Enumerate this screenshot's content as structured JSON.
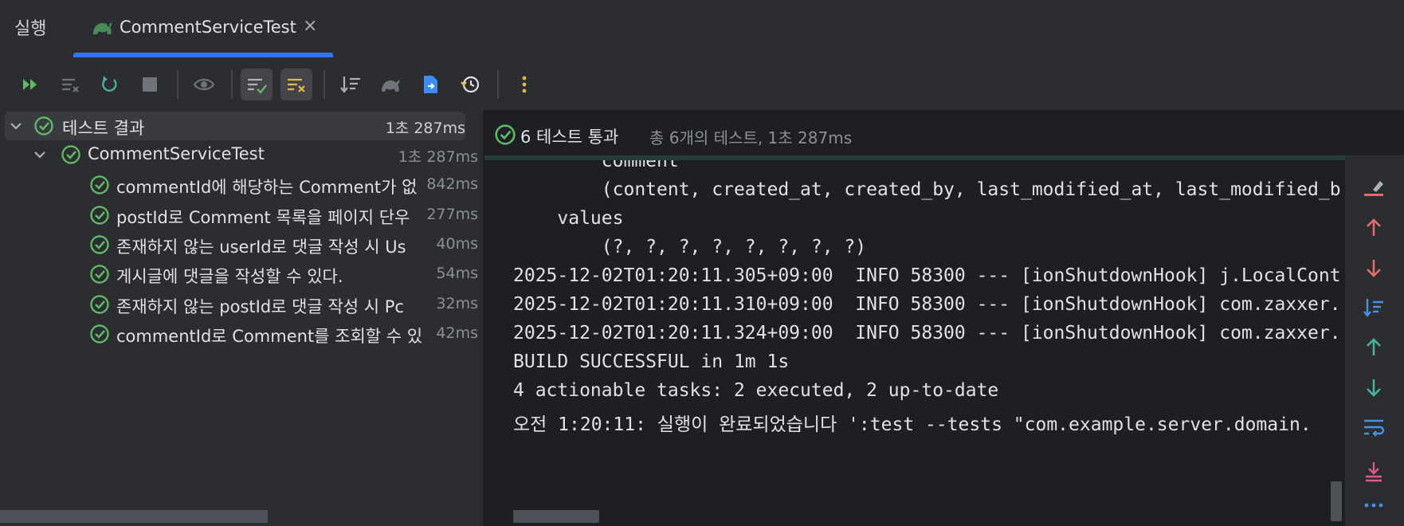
{
  "window": {
    "run_label": "실행",
    "tab_title": "CommentServiceTest",
    "tab_close": "×"
  },
  "toolbar": {
    "buttons": [
      {
        "icon": "rerun-failed-icon"
      },
      {
        "icon": "clear-icon"
      },
      {
        "icon": "rerun-icon"
      },
      {
        "icon": "stop-icon"
      },
      {
        "icon": "eye-icon"
      },
      {
        "icon": "show-passed-icon",
        "active": true
      },
      {
        "icon": "show-ignored-icon",
        "active": true
      },
      {
        "icon": "sort-icon"
      },
      {
        "icon": "gradle-icon"
      },
      {
        "icon": "export-icon"
      },
      {
        "icon": "history-icon"
      },
      {
        "icon": "more-icon"
      }
    ]
  },
  "tree": {
    "root": {
      "label": "테스트 결과",
      "time": "1초 287ms"
    },
    "suite": {
      "label": "CommentServiceTest",
      "time": "1초 287ms"
    },
    "tests": [
      {
        "label": "commentId에 해당하는 Comment가 없",
        "time": "842ms"
      },
      {
        "label": "postId로 Comment 목록을 페이지 단우",
        "time": "277ms"
      },
      {
        "label": "존재하지 않는 userId로 댓글 작성 시 Us",
        "time": "40ms"
      },
      {
        "label": "게시글에 댓글을 작성할 수 있다.",
        "time": "54ms"
      },
      {
        "label": "존재하지 않는 postId로 댓글 작성 시 Pc",
        "time": "32ms"
      },
      {
        "label": "commentId로 Comment를 조회할 수 있",
        "time": "42ms"
      }
    ]
  },
  "status": {
    "passed": "6 테스트 통과",
    "total": "총 6개의 테스트, 1초 287ms"
  },
  "console": {
    "lines": [
      "        comment",
      "        (content, created_at, created_by, last_modified_at, last_modified_b",
      "    values",
      "        (?, ?, ?, ?, ?, ?, ?, ?)",
      "2025-12-02T01:20:11.305+09:00  INFO 58300 --- [ionShutdownHook] j.LocalCont",
      "2025-12-02T01:20:11.310+09:00  INFO 58300 --- [ionShutdownHook] com.zaxxer.",
      "2025-12-02T01:20:11.324+09:00  INFO 58300 --- [ionShutdownHook] com.zaxxer.",
      "BUILD SUCCESSFUL in 1m 1s",
      "4 actionable tasks: 2 executed, 2 up-to-date",
      "오전 1:20:11: 실행이 완료되었습니다 ':test --tests \"com.example.server.domain."
    ]
  },
  "right_toolbar": [
    {
      "icon": "clear-console-icon"
    },
    {
      "icon": "arrow-up-red-icon"
    },
    {
      "icon": "arrow-down-red-icon"
    },
    {
      "icon": "sort-blue-icon"
    },
    {
      "icon": "arrow-up-icon"
    },
    {
      "icon": "arrow-down-icon"
    },
    {
      "icon": "soft-wrap-icon"
    },
    {
      "icon": "scroll-to-end-icon"
    },
    {
      "icon": "more-icon"
    }
  ],
  "colors": {
    "accent": "#3574f0",
    "pass": "#5fb865",
    "background": "#1e1f22",
    "panel": "#2b2d30"
  }
}
